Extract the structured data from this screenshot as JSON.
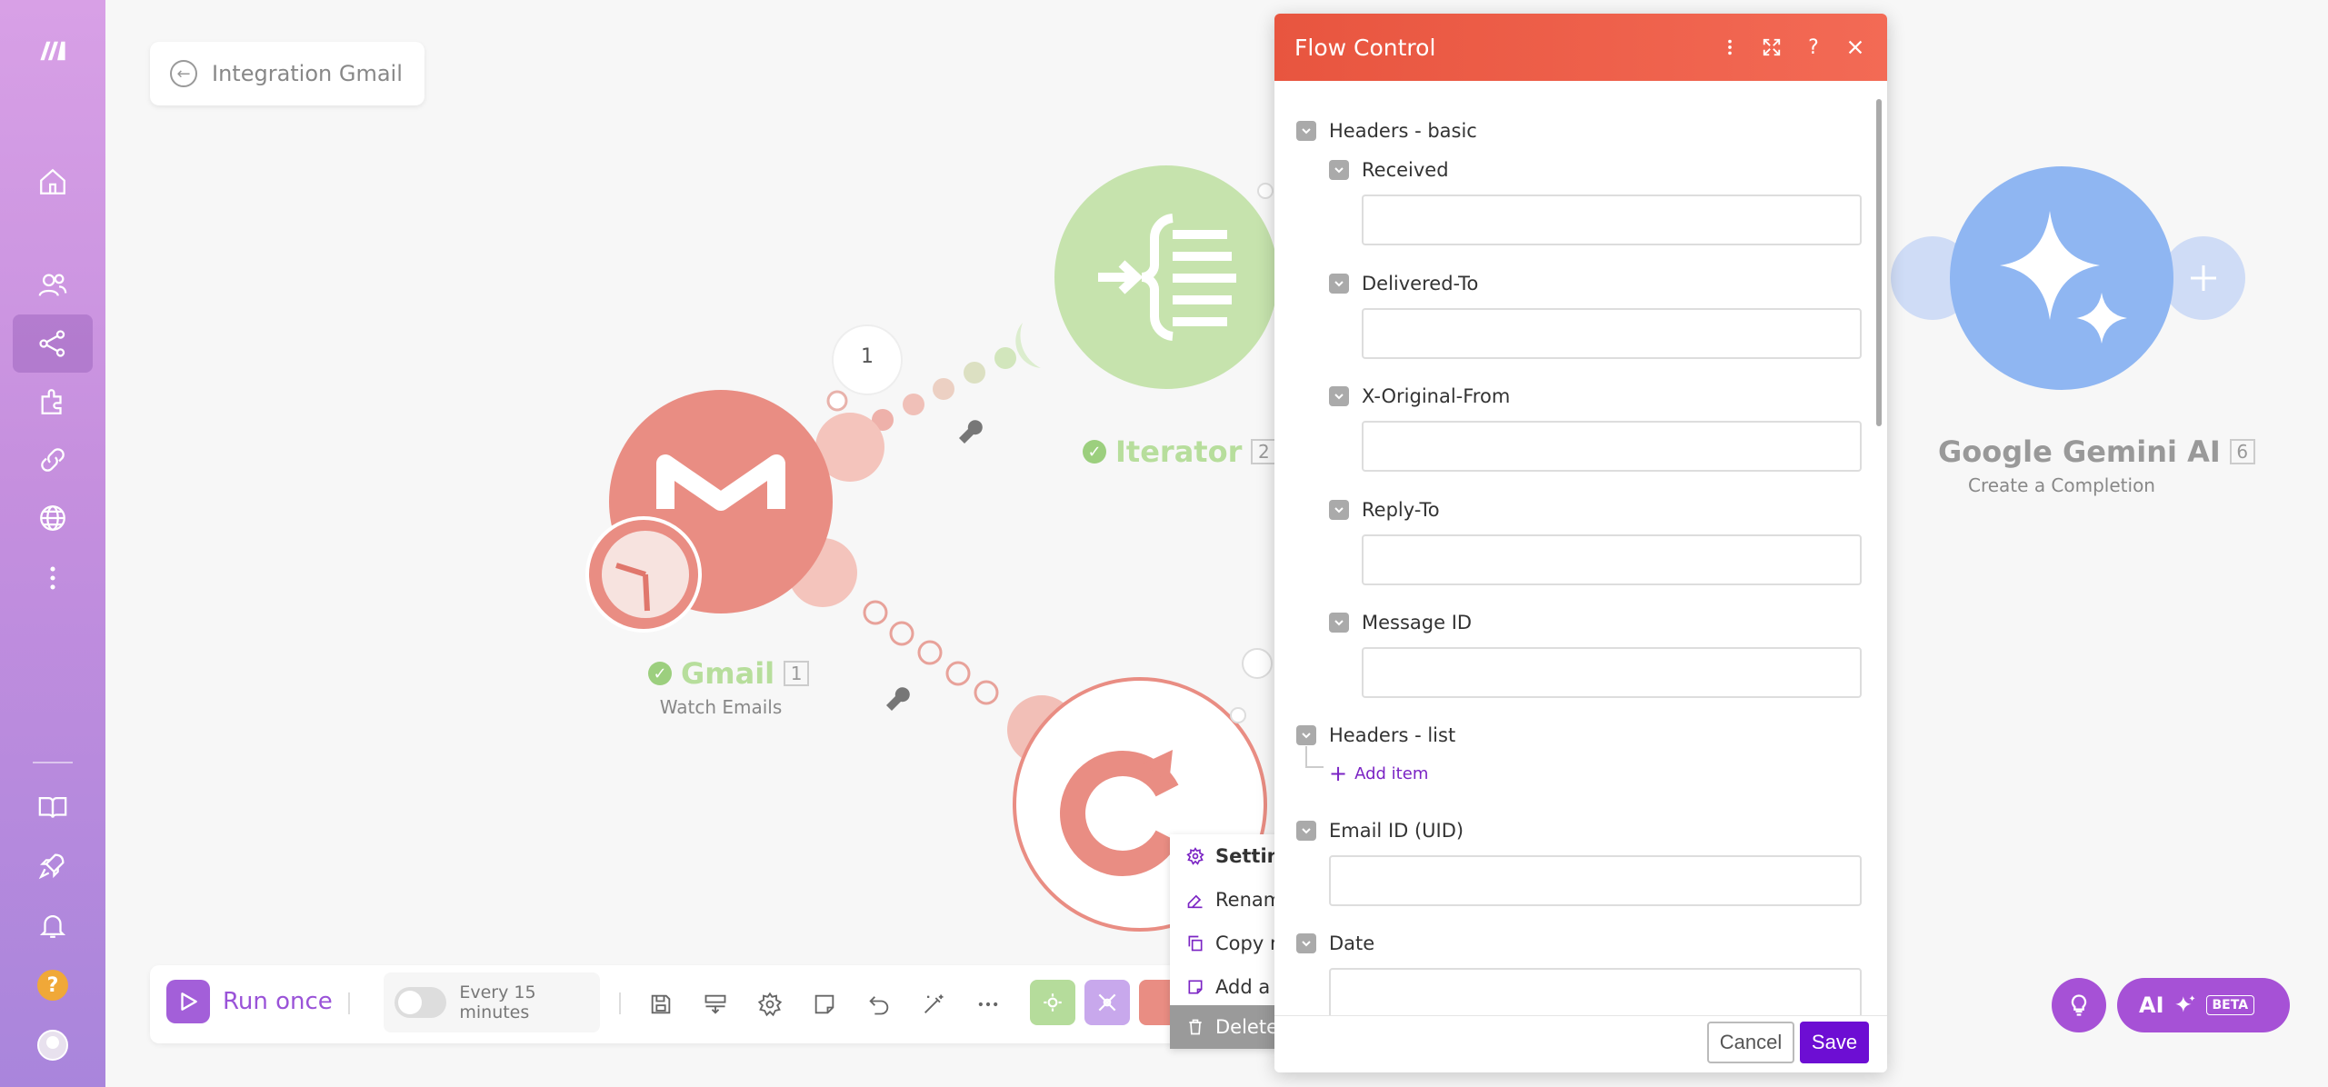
{
  "breadcrumb": {
    "title": "Integration Gmail"
  },
  "nodes": {
    "gmail": {
      "name": "Gmail",
      "number": "1",
      "subtitle": "Watch Emails"
    },
    "iterator": {
      "name": "Iterator",
      "number": "2"
    },
    "gemini": {
      "name": "Google Gemini AI",
      "number": "6",
      "subtitle": "Create a Completion"
    },
    "filter_count": "1"
  },
  "toolbar": {
    "run_label": "Run once",
    "schedule_label": "Every 15 minutes"
  },
  "context_menu": {
    "items": [
      "Settings",
      "Rename",
      "Copy module",
      "Add a note",
      "Delete module"
    ]
  },
  "dialog": {
    "title": "Flow Control",
    "fields": [
      {
        "label": "Headers - basic"
      },
      {
        "label": "Received",
        "value": ""
      },
      {
        "label": "Delivered-To",
        "value": ""
      },
      {
        "label": "X-Original-From",
        "value": ""
      },
      {
        "label": "Reply-To",
        "value": ""
      },
      {
        "label": "Message ID",
        "value": ""
      },
      {
        "label": "Headers - list"
      },
      {
        "label": "Email ID (UID)",
        "value": ""
      },
      {
        "label": "Date",
        "value": ""
      }
    ],
    "add_item_label": "Add item",
    "cancel_label": "Cancel",
    "save_label": "Save"
  },
  "ai": {
    "label": "AI",
    "badge": "BETA"
  },
  "colors": {
    "accent": "#6d0ed3",
    "header": "#ec5a45",
    "gmail": "#e98d83",
    "iterator": "#c6e3ad",
    "gemini": "#8fb6f2"
  }
}
